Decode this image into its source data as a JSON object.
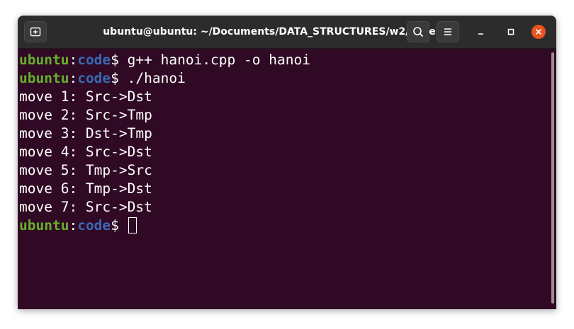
{
  "window": {
    "title": "ubuntu@ubuntu: ~/Documents/DATA_STRUCTURES/w2/code"
  },
  "icons": {
    "new_tab": "new-tab-icon",
    "search": "search-icon",
    "menu": "hamburger-menu-icon",
    "minimize": "minimize-icon",
    "maximize": "maximize-icon",
    "close": "close-icon"
  },
  "colors": {
    "terminal_bg": "#300a24",
    "titlebar_bg": "#2c2c2c",
    "prompt_user": "#66b02c",
    "prompt_path": "#3a68b3",
    "close_button": "#e95420"
  },
  "prompt": {
    "user": "ubuntu",
    "separator": ":",
    "path": "code",
    "symbol": "$"
  },
  "terminal": {
    "commands": [
      " g++ hanoi.cpp -o hanoi",
      " ./hanoi"
    ],
    "output": [
      "move 1: Src->Dst",
      "move 2: Src->Tmp",
      "move 3: Dst->Tmp",
      "move 4: Src->Dst",
      "move 5: Tmp->Src",
      "move 6: Tmp->Dst",
      "move 7: Src->Dst"
    ]
  }
}
